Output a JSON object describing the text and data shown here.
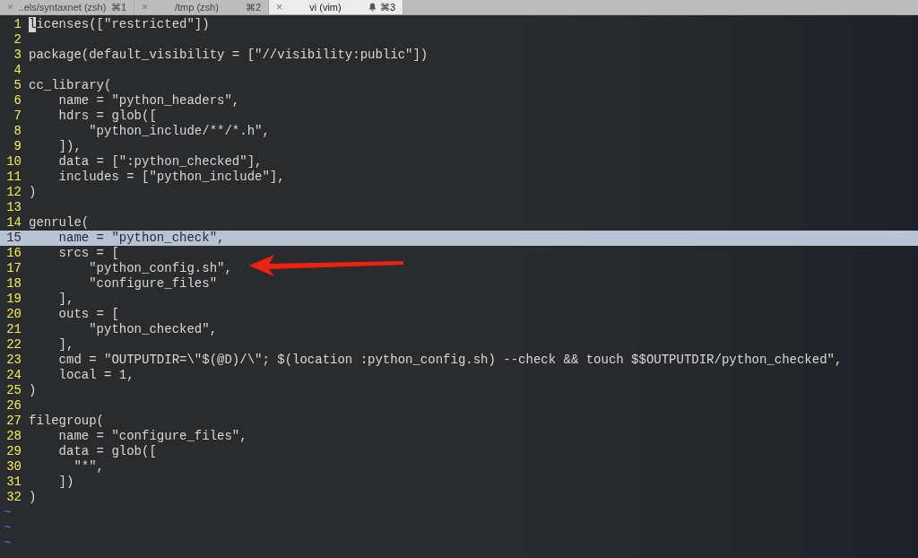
{
  "tabs": [
    {
      "close": "×",
      "label": "..els/syntaxnet (zsh)",
      "shortcut": "⌘1",
      "selected": false,
      "bell": false
    },
    {
      "close": "×",
      "label": "/tmp (zsh)",
      "shortcut": "⌘2",
      "selected": false,
      "bell": false
    },
    {
      "close": "×",
      "label": "vi (vim)",
      "shortcut": "⌘3",
      "selected": true,
      "bell": true
    }
  ],
  "editor": {
    "lines": [
      {
        "number": "1",
        "text": "licenses([\"restricted\"])",
        "current": false,
        "cursor": true
      },
      {
        "number": "2",
        "current": false,
        "cursor": false
      },
      {
        "number": "3",
        "text": "package(default_visibility = [\"//visibility:public\"])",
        "current": false,
        "cursor": false
      },
      {
        "number": "4",
        "current": false,
        "cursor": false
      },
      {
        "number": "5",
        "text": "cc_library(",
        "current": false,
        "cursor": false
      },
      {
        "number": "6",
        "text": "    name = \"python_headers\",",
        "current": false,
        "cursor": false
      },
      {
        "number": "7",
        "text": "    hdrs = glob([",
        "current": false,
        "cursor": false
      },
      {
        "number": "8",
        "text": "        \"python_include/**/*.h\",",
        "current": false,
        "cursor": false
      },
      {
        "number": "9",
        "text": "    ]),",
        "current": false,
        "cursor": false
      },
      {
        "number": "10",
        "text": "    data = [\":python_checked\"],",
        "current": false,
        "cursor": false
      },
      {
        "number": "11",
        "text": "    includes = [\"python_include\"],",
        "current": false,
        "cursor": false
      },
      {
        "number": "12",
        "text": ")",
        "current": false,
        "cursor": false
      },
      {
        "number": "13",
        "current": false,
        "cursor": false
      },
      {
        "number": "14",
        "text": "genrule(",
        "current": false,
        "cursor": false
      },
      {
        "number": "15",
        "text": "    name = \"python_check\",",
        "current": true,
        "cursor": false
      },
      {
        "number": "16",
        "text": "    srcs = [",
        "current": false,
        "cursor": false
      },
      {
        "number": "17",
        "text": "        \"python_config.sh\",",
        "current": false,
        "cursor": false
      },
      {
        "number": "18",
        "text": "        \"configure_files\"",
        "current": false,
        "cursor": false
      },
      {
        "number": "19",
        "text": "    ],",
        "current": false,
        "cursor": false
      },
      {
        "number": "20",
        "text": "    outs = [",
        "current": false,
        "cursor": false
      },
      {
        "number": "21",
        "text": "        \"python_checked\",",
        "current": false,
        "cursor": false
      },
      {
        "number": "22",
        "text": "    ],",
        "current": false,
        "cursor": false
      },
      {
        "number": "23",
        "text": "    cmd = \"OUTPUTDIR=\\\"$(@D)/\\\"; $(location :python_config.sh) --check && touch $$OUTPUTDIR/python_checked\",",
        "current": false,
        "cursor": false
      },
      {
        "number": "24",
        "text": "    local = 1,",
        "current": false,
        "cursor": false
      },
      {
        "number": "25",
        "text": ")",
        "current": false,
        "cursor": false
      },
      {
        "number": "26",
        "current": false,
        "cursor": false
      },
      {
        "number": "27",
        "text": "filegroup(",
        "current": false,
        "cursor": false
      },
      {
        "number": "28",
        "text": "    name = \"configure_files\",",
        "current": false,
        "cursor": false
      },
      {
        "number": "29",
        "text": "    data = glob([",
        "current": false,
        "cursor": false
      },
      {
        "number": "30",
        "text": "      \"*\",",
        "current": false,
        "cursor": false
      },
      {
        "number": "31",
        "text": "    ])",
        "current": false,
        "cursor": false
      },
      {
        "number": "32",
        "text": ")",
        "current": false,
        "cursor": false
      }
    ],
    "empty_lines": [
      "~",
      "~",
      "~"
    ]
  }
}
